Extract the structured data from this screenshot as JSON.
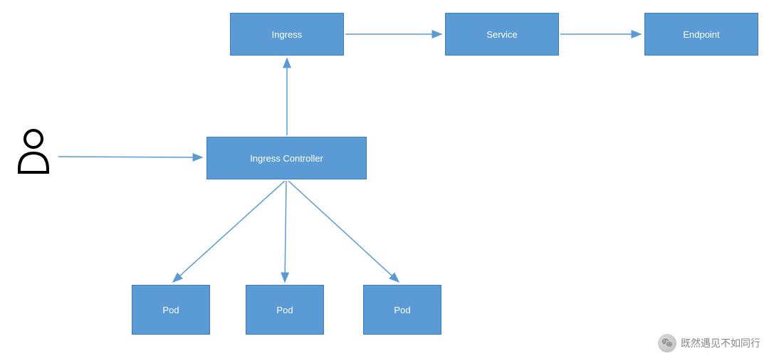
{
  "nodes": {
    "ingress": {
      "label": "Ingress"
    },
    "service": {
      "label": "Service"
    },
    "endpoint": {
      "label": "Endpoint"
    },
    "ingressController": {
      "label": "Ingress Controller"
    },
    "pod1": {
      "label": "Pod"
    },
    "pod2": {
      "label": "Pod"
    },
    "pod3": {
      "label": "Pod"
    }
  },
  "watermark": {
    "text": "既然遇见不如同行"
  },
  "colors": {
    "boxFill": "#5b9bd5",
    "boxBorder": "#3a7fc4",
    "arrow": "#5b9bd5"
  }
}
